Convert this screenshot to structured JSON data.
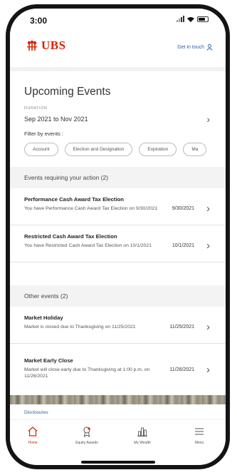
{
  "status_bar": {
    "time": "3:00"
  },
  "header": {
    "logo_text": "UBS",
    "get_in_touch": "Get in touch"
  },
  "upcoming": {
    "title": "Upcoming Events",
    "duration_label": "DURATION",
    "duration_value": "Sep 2021 to Nov 2021",
    "filter_label": "Filter by events :",
    "chips": [
      "Account",
      "Election and Designation",
      "Expiration",
      "Ma"
    ]
  },
  "action_section": {
    "heading": "Events requiring your action (2)",
    "events": [
      {
        "title": "Performance Cash Award Tax Election",
        "description": "You have Performance Cash Award Tax Election on 9/30/2021",
        "date": "9/30/2021"
      },
      {
        "title": "Restricted Cash Award Tax Election",
        "description": "You have Restricted Cash Award Tax Election on 10/1/2021",
        "date": "10/1/2021"
      }
    ]
  },
  "other_section": {
    "heading": "Other events (2)",
    "events": [
      {
        "title": "Market Holiday",
        "description": "Market is closed due to Thanksgiving on 11/25/2021",
        "date": "11/25/2021"
      },
      {
        "title": "Market Early Close",
        "description": "Market will close early due to Thanksgiving at 1:00 p.m. on 11/26/2021",
        "date": "11/26/2021"
      }
    ]
  },
  "footer": {
    "disclosures": "Disclosures"
  },
  "tabs": [
    {
      "label": "Home",
      "icon": "home-icon",
      "active": true
    },
    {
      "label": "Equity Awards",
      "icon": "award-icon",
      "active": false
    },
    {
      "label": "My Wealth",
      "icon": "bar-chart-icon",
      "active": false
    },
    {
      "label": "Menu",
      "icon": "menu-icon",
      "active": false
    }
  ],
  "colors": {
    "brand_red": "#d62400",
    "link_blue": "#2b5fa8"
  }
}
